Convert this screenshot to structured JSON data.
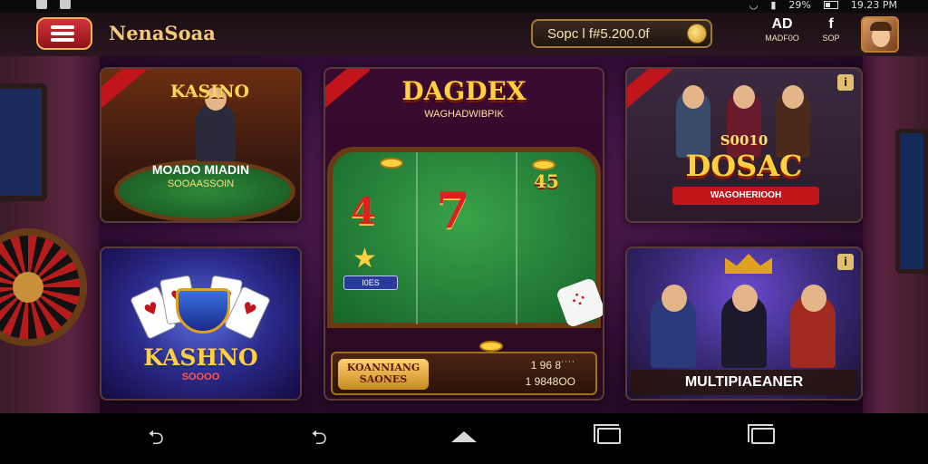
{
  "status_bar": {
    "battery": "29%",
    "time": "19.23 PM"
  },
  "app_bar": {
    "title": "NenaSoaa",
    "balance_label": "Sopc l f#5.200.0f",
    "actions": [
      {
        "glyph": "AD",
        "label": "MADF0O"
      },
      {
        "glyph": "f",
        "label": "SOP"
      }
    ]
  },
  "cards": {
    "card1": {
      "logo": "KASINO",
      "line1": "MOADO MIADIN",
      "line2": "SOOAASSOIN"
    },
    "card2": {
      "logo": "KASHNO",
      "sub": "SOOOO"
    },
    "card3": {
      "logo": "DAGDEX",
      "sub": "WAGHADWIBPIK",
      "sym_4": "4",
      "sym_7": "7",
      "sym_45": "45",
      "tag": "I0ES",
      "footer_label_1": "KOANNIANG",
      "footer_label_2": "SAONES",
      "footer_num_1": "1 96 8˙˙˙˙",
      "footer_num_2": "1 9848OO"
    },
    "card4": {
      "logo_small": "S0010",
      "logo_big": "DOSAC",
      "banner": "WAGOHERIOOH",
      "info": "i"
    },
    "card5": {
      "label": "MULTIPIAEANER",
      "info": "i"
    }
  },
  "colors": {
    "accent_gold": "#ffd040",
    "accent_red": "#c0161b",
    "felt_green": "#2e8a3a"
  }
}
